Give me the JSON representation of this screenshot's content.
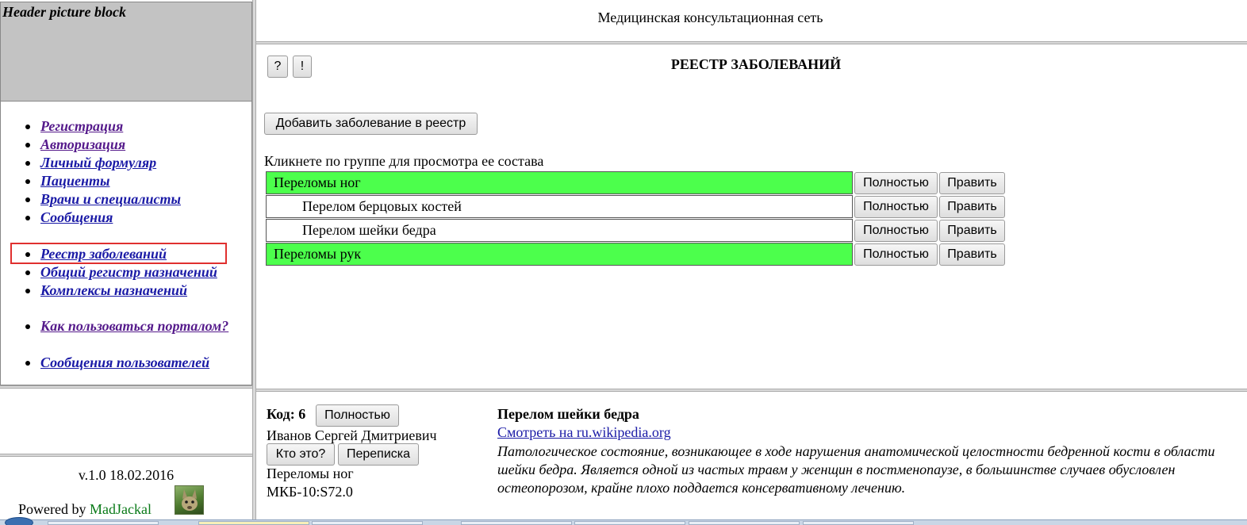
{
  "sidebar": {
    "header_picture_label": "Header picture block",
    "menu_group_1": [
      {
        "label": "Регистрация"
      },
      {
        "label": "Авторизация"
      },
      {
        "label": "Личный формуляр"
      },
      {
        "label": "Пациенты"
      },
      {
        "label": "Врачи и специалисты"
      },
      {
        "label": "Сообщения"
      }
    ],
    "menu_group_2": [
      {
        "label": "Реестр заболеваний"
      },
      {
        "label": "Общий регистр назначений"
      },
      {
        "label": "Комплексы назначений"
      }
    ],
    "help_link": "Как пользоваться порталом?",
    "user_messages_link": "Сообщения пользователей",
    "version": "v.1.0 18.02.2016",
    "powered_prefix": "Powered by ",
    "powered_brand": "MadJackal",
    "active_item": "Реестр заболеваний",
    "colors": {
      "link": "#1a1aa6",
      "visited": "#551a8b",
      "brand": "#0a7a18",
      "highlight": "#e0302f"
    }
  },
  "header": {
    "site_title": "Медицинская консультационная сеть"
  },
  "main": {
    "help_button": "?",
    "info_button": "!",
    "page_heading": "РЕЕСТР ЗАБОЛЕВАНИЙ",
    "add_button": "Добавить заболевание в реестр",
    "hint": "Кликнете по группе для просмотра ее состава",
    "rows": [
      {
        "name": "Переломы ног",
        "type": "group",
        "full_label": "Полностью",
        "edit_label": "Править"
      },
      {
        "name": "Перелом берцовых костей",
        "type": "item",
        "full_label": "Полностью",
        "edit_label": "Править"
      },
      {
        "name": "Перелом шейки бедра",
        "type": "item",
        "full_label": "Полностью",
        "edit_label": "Править"
      },
      {
        "name": "Переломы рук",
        "type": "group",
        "full_label": "Полностью",
        "edit_label": "Править"
      }
    ],
    "group_color": "#4cff4c"
  },
  "detail": {
    "code_label": "Код: 6",
    "full_button": "Полностью",
    "person": "Иванов Сергей Дмитриевич",
    "who_button": "Кто это?",
    "chat_button": "Переписка",
    "group": "Переломы ног",
    "mkb": "МКБ-10:S72.0",
    "disease_title": "Перелом шейки бедра",
    "wiki_link": "Смотреть на ru.wikipedia.org",
    "description": "Патологическое состояние, возникающее в ходе нарушения анатомической целостности бедренной кости в области шейки бедра. Является одной из частых травм у женщин в постменопаузе, в большинстве случаев обусловлен остеопорозом, крайне плохо поддается консервативному лечению."
  }
}
